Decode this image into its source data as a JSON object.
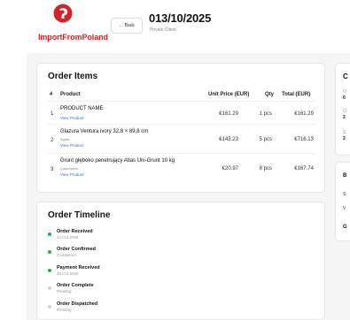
{
  "brand": {
    "name": "ImportFromPoland",
    "color": "#d2232a"
  },
  "header": {
    "back_label": "← Back",
    "order_date": "013/10/2025",
    "client_type": "Private Client"
  },
  "order_items": {
    "title": "Order Items",
    "columns": [
      "#",
      "Product",
      "Unit Price (EUR)",
      "Qty",
      "Total (EUR)"
    ],
    "rows": [
      {
        "num": "1",
        "name": "PRODUCT NAME",
        "brand": "",
        "link": "View Product",
        "unit_price": "€161.29",
        "qty": "1 pcs",
        "total": "€161.29"
      },
      {
        "num": "2",
        "name": "Glazura Ventura ivory 32,8 × 89,8 cm",
        "brand": "Agata",
        "link": "View Product",
        "unit_price": "€143.23",
        "qty": "5 pcs",
        "total": "€716.13"
      },
      {
        "num": "3",
        "name": "Grunt głęboko penetrujący Atlas Uni-Grunt 10 kg",
        "brand": "Castorama",
        "link": "View Product",
        "unit_price": "€20.97",
        "qty": "8 pcs",
        "total": "€167.74"
      }
    ]
  },
  "order_timeline": {
    "title": "Order Timeline",
    "events": [
      {
        "title": "Order Received",
        "sub": "24 Oct 2025",
        "status": "done",
        "color": "#22b04b"
      },
      {
        "title": "Order Confirmed",
        "sub": "Completed",
        "status": "done",
        "color": "#22b04b"
      },
      {
        "title": "Payment Received",
        "sub": "28 Oct 2025",
        "status": "done",
        "color": "#22b04b"
      },
      {
        "title": "Order Complete",
        "sub": "Pending",
        "status": "pending",
        "color": "#cfcfcf"
      },
      {
        "title": "Order Dispatched",
        "sub": "Pending",
        "status": "pending",
        "color": "#cfcfcf"
      }
    ]
  },
  "side_panel": {
    "card1_head": "C",
    "card1_lines": [
      "O",
      "0",
      "O",
      "2",
      "S",
      "2"
    ],
    "card2_head": "B",
    "card2_lines": [
      "S",
      "V",
      "G"
    ]
  }
}
